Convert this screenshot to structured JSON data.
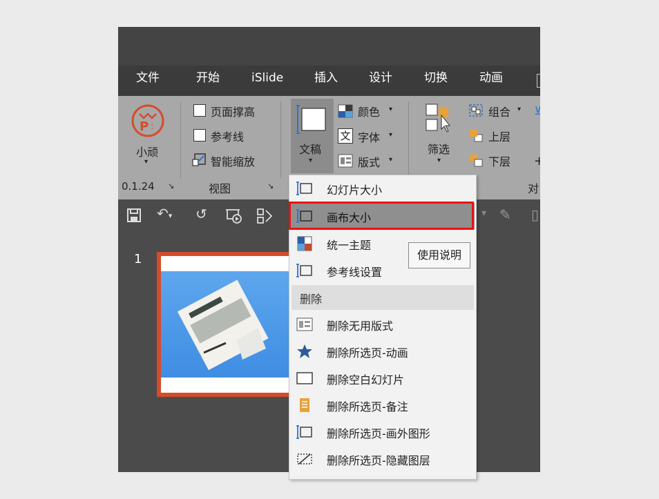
{
  "tabs": [
    "文件",
    "开始",
    "iSlide",
    "插入",
    "设计",
    "切换",
    "动画"
  ],
  "ribbon": {
    "xiaowan_label": "小顽",
    "version": "0.1.24",
    "view_group": {
      "items": [
        "页面撑高",
        "参考线",
        "智能缩放"
      ],
      "group_label": "视图"
    },
    "document_label": "文稿",
    "document_items": [
      "颜色",
      "字体",
      "版式"
    ],
    "filter_label": "筛选",
    "arrange_items": [
      "组合",
      "上层",
      "下层"
    ],
    "align_partial": "对"
  },
  "slide_panel": {
    "slide_number": "1"
  },
  "dropdown": {
    "items_top": [
      "幻灯片大小",
      "画布大小",
      "统一主题",
      "参考线设置"
    ],
    "section_header": "删除",
    "items_delete": [
      "删除无用版式",
      "删除所选页-动画",
      "删除空白幻灯片",
      "删除所选页-备注",
      "删除所选页-画外图形",
      "删除所选页-隐藏图层"
    ],
    "selected": "画布大小"
  },
  "tooltip": "使用说明",
  "colors": {
    "accent": "#d54c2a",
    "highlight": "#e11111",
    "ribbon": "#a8a8a8",
    "tabbar": "#3b3b3b"
  }
}
